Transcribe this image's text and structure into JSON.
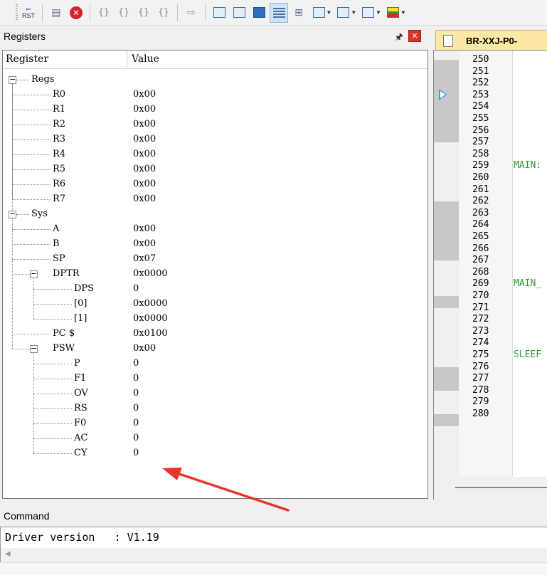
{
  "toolbar": {
    "rst_label": "RST",
    "buttons": [
      {
        "icon": "reset-icon"
      },
      {
        "icon": "run-icon"
      },
      {
        "icon": "stop-icon"
      },
      {
        "icon": "step-into-icon"
      },
      {
        "icon": "step-over-icon"
      },
      {
        "icon": "step-out-icon"
      },
      {
        "icon": "run-to-cursor-icon"
      },
      {
        "icon": "show-next-statement-icon"
      },
      {
        "icon": "command-window-icon"
      },
      {
        "icon": "disassembly-window-icon"
      },
      {
        "icon": "symbols-window-icon"
      },
      {
        "icon": "registers-window-icon"
      },
      {
        "icon": "call-stack-window-icon"
      },
      {
        "icon": "watch-window-icon"
      },
      {
        "icon": "memory-window-icon"
      },
      {
        "icon": "serial-window-icon"
      },
      {
        "icon": "analysis-window-icon"
      }
    ]
  },
  "registers": {
    "title": "Registers",
    "columns": {
      "register": "Register",
      "value": "Value"
    },
    "rows": [
      {
        "name": "Regs",
        "value": "",
        "level": 0,
        "toggle": "⊟"
      },
      {
        "name": "R0",
        "value": "0x00",
        "level": 1
      },
      {
        "name": "R1",
        "value": "0x00",
        "level": 1
      },
      {
        "name": "R2",
        "value": "0x00",
        "level": 1
      },
      {
        "name": "R3",
        "value": "0x00",
        "level": 1
      },
      {
        "name": "R4",
        "value": "0x00",
        "level": 1
      },
      {
        "name": "R5",
        "value": "0x00",
        "level": 1
      },
      {
        "name": "R6",
        "value": "0x00",
        "level": 1
      },
      {
        "name": "R7",
        "value": "0x00",
        "level": 1
      },
      {
        "name": "Sys",
        "value": "",
        "level": 0,
        "toggle": "⊟"
      },
      {
        "name": "A",
        "value": "0x00",
        "level": 1
      },
      {
        "name": "B",
        "value": "0x00",
        "level": 1
      },
      {
        "name": "SP",
        "value": "0x07",
        "level": 1
      },
      {
        "name": "DPTR",
        "value": "0x0000",
        "level": 1,
        "toggle": "⊟"
      },
      {
        "name": "DPS",
        "value": "0",
        "level": 2
      },
      {
        "name": "[0]",
        "value": "0x0000",
        "level": 2
      },
      {
        "name": "[1]",
        "value": "0x0000",
        "level": 2
      },
      {
        "name": "PC $",
        "value": "0x0100",
        "level": 1
      },
      {
        "name": "PSW",
        "value": "0x00",
        "level": 1,
        "toggle": "⊟"
      },
      {
        "name": "P",
        "value": "0",
        "level": 2
      },
      {
        "name": "F1",
        "value": "0",
        "level": 2
      },
      {
        "name": "OV",
        "value": "0",
        "level": 2
      },
      {
        "name": "RS",
        "value": "0",
        "level": 2
      },
      {
        "name": "F0",
        "value": "0",
        "level": 2
      },
      {
        "name": "AC",
        "value": "0",
        "level": 2
      },
      {
        "name": "CY",
        "value": "0",
        "level": 2
      }
    ]
  },
  "editor": {
    "tab_title": "BR-XXJ-P0-",
    "line_numbers": [
      "250",
      "251",
      "252",
      "253",
      "254",
      "255",
      "256",
      "257",
      "258",
      "259",
      "260",
      "261",
      "262",
      "263",
      "264",
      "265",
      "266",
      "267",
      "268",
      "269",
      "270",
      "271",
      "272",
      "273",
      "274",
      "275",
      "276",
      "277",
      "278",
      "279",
      "280"
    ],
    "labels": [
      {
        "line": "259",
        "text": "MAIN:"
      },
      {
        "line": "269",
        "text": "MAIN_"
      },
      {
        "line": "275",
        "text": "SLEEF"
      }
    ]
  },
  "command": {
    "title": "Command",
    "output": "Driver version   : V1.19"
  },
  "colors": {
    "annotation_arrow": "#e8342a",
    "label_green": "#2e9a2e",
    "tab_yellow": "#fce9a6"
  }
}
